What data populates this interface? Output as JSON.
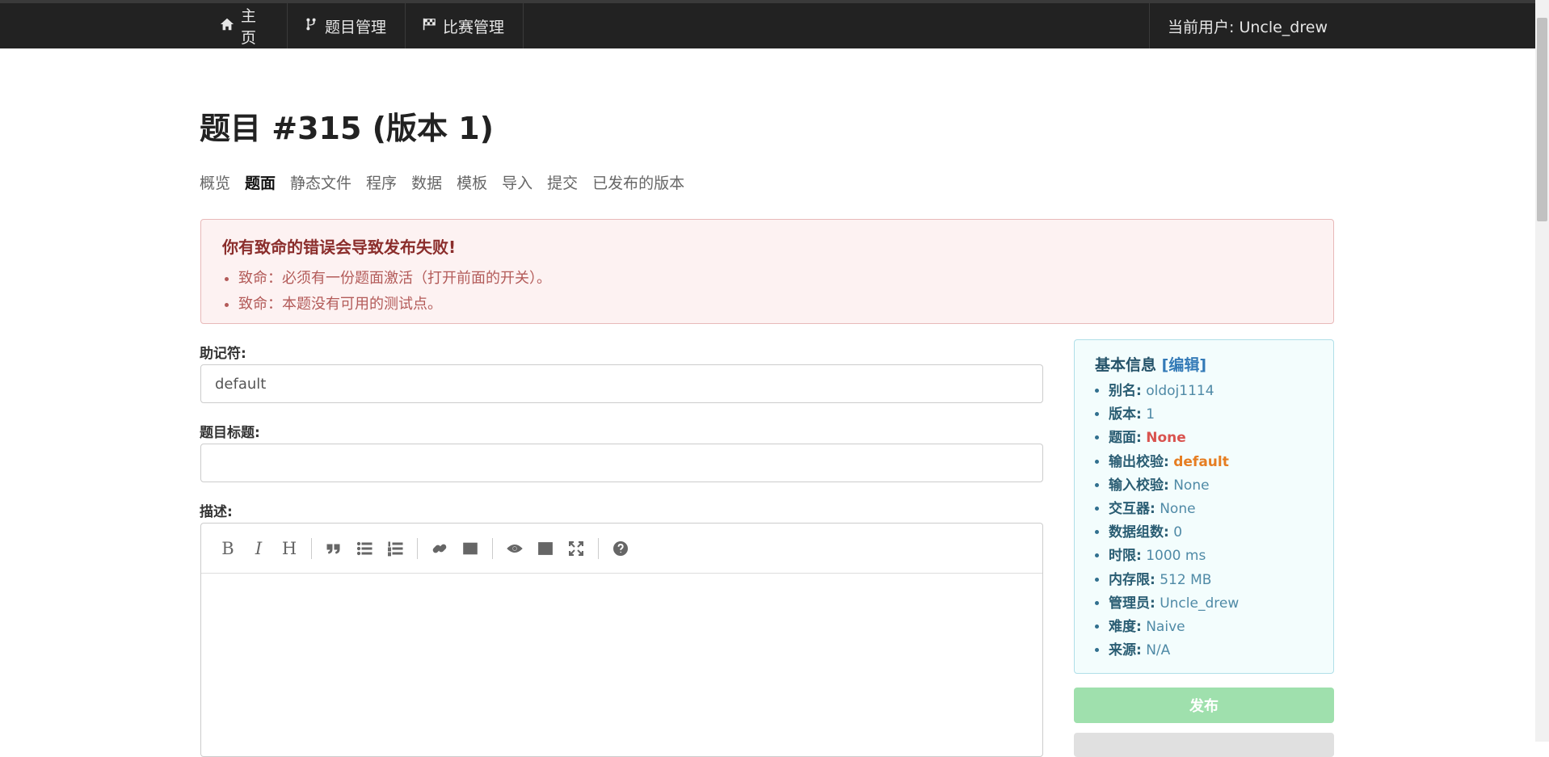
{
  "nav": {
    "home_label": "主页",
    "problems_label": "题目管理",
    "contests_label": "比赛管理",
    "user_label": "当前用户: Uncle_drew"
  },
  "page": {
    "title": "题目 #315 (版本 1)"
  },
  "tabs": [
    {
      "label": "概览",
      "active": false
    },
    {
      "label": "题面",
      "active": true
    },
    {
      "label": "静态文件",
      "active": false
    },
    {
      "label": "程序",
      "active": false
    },
    {
      "label": "数据",
      "active": false
    },
    {
      "label": "模板",
      "active": false
    },
    {
      "label": "导入",
      "active": false
    },
    {
      "label": "提交",
      "active": false
    },
    {
      "label": "已发布的版本",
      "active": false
    }
  ],
  "alert": {
    "title": "你有致命的错误会导致发布失败!",
    "items": [
      "致命：必须有一份题面激活（打开前面的开关）。",
      "致命：本题没有可用的测试点。"
    ]
  },
  "form": {
    "mnemonic_label": "助记符:",
    "mnemonic_value": "default",
    "title_label": "题目标题:",
    "title_value": "",
    "description_label": "描述:"
  },
  "editor_toolbar": {
    "icons": [
      "bold-icon",
      "italic-icon",
      "heading-icon",
      "quote-icon",
      "unordered-list-icon",
      "ordered-list-icon",
      "link-icon",
      "image-icon",
      "preview-icon",
      "side-by-side-icon",
      "fullscreen-icon",
      "guide-icon"
    ],
    "bold_glyph": "B",
    "italic_glyph": "I",
    "heading_glyph": "H"
  },
  "info": {
    "title": "基本信息",
    "edit_link": "[编辑]",
    "rows": [
      {
        "key": "别名",
        "value": "oldoj1114",
        "style": "normal"
      },
      {
        "key": "版本",
        "value": "1",
        "style": "normal"
      },
      {
        "key": "题面",
        "value": "None",
        "style": "red"
      },
      {
        "key": "输出校验",
        "value": "default",
        "style": "orange"
      },
      {
        "key": "输入校验",
        "value": "None",
        "style": "normal"
      },
      {
        "key": "交互器",
        "value": "None",
        "style": "normal"
      },
      {
        "key": "数据组数",
        "value": "0",
        "style": "normal"
      },
      {
        "key": "时限",
        "value": "1000 ms",
        "style": "normal"
      },
      {
        "key": "内存限",
        "value": "512 MB",
        "style": "normal"
      },
      {
        "key": "管理员",
        "value": "Uncle_drew",
        "style": "normal"
      },
      {
        "key": "难度",
        "value": "Naive",
        "style": "normal"
      },
      {
        "key": "来源",
        "value": "N/A",
        "style": "normal"
      }
    ]
  },
  "publish_label": "发布",
  "colors": {
    "topbar_bg": "#222222",
    "alert_bg": "#fdf2f2",
    "alert_text": "#a94442",
    "info_bg": "#f3fdfd",
    "publish_bg": "#9fe0ad",
    "danger": "#d9534f",
    "warning": "#e67e22"
  }
}
